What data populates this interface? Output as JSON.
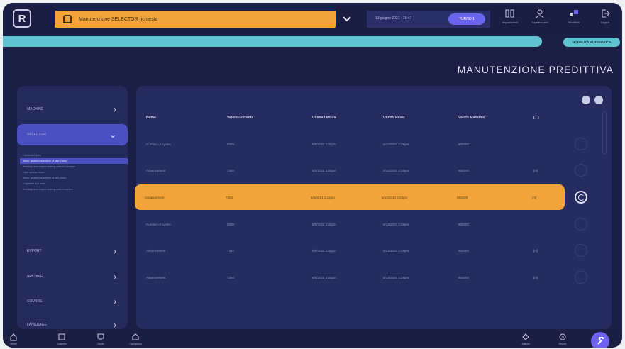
{
  "topbar": {
    "logo_letter": "R",
    "alarm_text": "Manutenzione SELECTOR richiesta",
    "date_text": "13 giugno 2021 - 15:47",
    "shift_label": "TURNO 1",
    "icons": [
      {
        "name": "impostazioni-icon",
        "label": "Impostazioni"
      },
      {
        "name": "supervisione-icon",
        "label": "Supervisione"
      },
      {
        "name": "workflow-icon",
        "label": "Workflow"
      },
      {
        "name": "logout-icon",
        "label": "Logout"
      }
    ]
  },
  "status": {
    "mode_label": "MODALITÀ AUTOMATICA",
    "accent": "#61c3d0"
  },
  "page": {
    "title": "MANUTENZIONE PREDITTIVA"
  },
  "sidebar": {
    "items": [
      {
        "label": "MACHINE",
        "chev": "›"
      },
      {
        "label": "SELECTOR",
        "chev": "⌄"
      },
      {
        "label": "EXPORT",
        "chev": "›"
      },
      {
        "label": "ARCHIVE",
        "chev": "›"
      },
      {
        "label": "SOUNDS",
        "chev": "›"
      },
      {
        "label": "LANGUAGE",
        "chev": "›"
      }
    ],
    "sub_items": [
      "Cardboard lamp",
      "Motor, gearbox and drive of bins (rows)",
      "Bearings and hinged bearing units of conveyor",
      "Card ejection board",
      "Motor, gearbox and drive of belt (rows)",
      "Cogwheel and ends",
      "Bearings and hinged bearing units of sorters"
    ],
    "active_sub_index": 1
  },
  "table": {
    "headers": [
      "Nome",
      "Valore Corrente",
      "Ultima Lettura",
      "Ultimo Reset",
      "Valore Massimo",
      "[...]"
    ],
    "rows": [
      {
        "cells": [
          "Number of cycles",
          "2088",
          "6/8/2021 2:32pm",
          "5/14/2020 3:28pm",
          "850000",
          ""
        ],
        "highlight": false
      },
      {
        "cells": [
          "Advancement",
          "7393",
          "6/8/2021 2:32pm",
          "5/14/2020 3:28pm",
          "850000",
          "[m]"
        ],
        "highlight": false
      },
      {
        "cells": [
          "Advancement",
          "7393",
          "6/8/2021 2:32pm",
          "5/14/2020 3:28pm",
          "850000",
          "[m]"
        ],
        "highlight": true
      },
      {
        "cells": [
          "Number of cycles",
          "2088",
          "6/8/2021 2:32pm",
          "5/14/2020 3:28pm",
          "850000",
          ""
        ],
        "highlight": false
      },
      {
        "cells": [
          "Advancement",
          "7393",
          "6/8/2021 2:32pm",
          "5/14/2020 3:28pm",
          "850000",
          "[m]"
        ],
        "highlight": false
      },
      {
        "cells": [
          "Advancement",
          "7393",
          "6/8/2021 2:32pm",
          "5/14/2020 3:28pm",
          "850000",
          "[m]"
        ],
        "highlight": false
      }
    ]
  },
  "bottombar": {
    "left": [
      {
        "name": "home-icon",
        "label": "Home"
      },
      {
        "name": "cassette-icon",
        "label": "Cassette"
      },
      {
        "name": "mode-icon",
        "label": "Mode"
      },
      {
        "name": "operations-icon",
        "label": "Operations"
      }
    ],
    "right": [
      {
        "name": "alarms-icon",
        "label": "Allarmi"
      },
      {
        "name": "history-icon",
        "label": "Report"
      }
    ],
    "fab_icon": "wrench-icon"
  }
}
